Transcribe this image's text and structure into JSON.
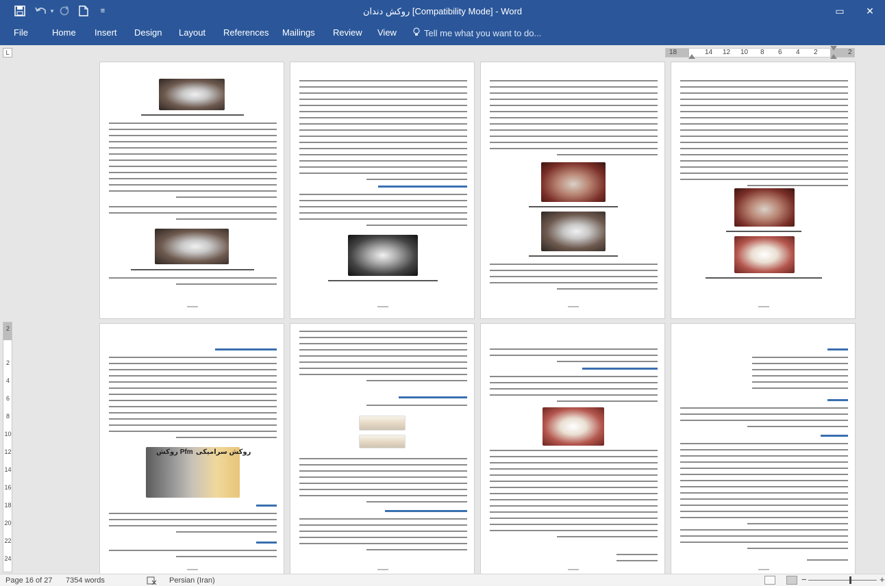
{
  "app": {
    "title": "روکش دندان [Compatibility Mode] - Word"
  },
  "quick_access": {
    "save_icon": "save-icon",
    "undo_icon": "undo-icon",
    "redo_icon": "redo-icon",
    "new_icon": "new-document-icon",
    "customize_icon": "customize-qat-icon"
  },
  "window_controls": {
    "ribbon_display": "▭",
    "minimize": "—",
    "maximize": "❐",
    "close": "✕"
  },
  "ribbon": {
    "tabs": [
      {
        "label": "File"
      },
      {
        "label": "Home"
      },
      {
        "label": "Insert"
      },
      {
        "label": "Design"
      },
      {
        "label": "Layout"
      },
      {
        "label": "References"
      },
      {
        "label": "Mailings"
      },
      {
        "label": "Review"
      },
      {
        "label": "View"
      }
    ],
    "tell_me": "Tell me what you want to do..."
  },
  "ruler": {
    "corner": "L",
    "ticks": [
      "18",
      "14",
      "12",
      "10",
      "8",
      "6",
      "4",
      "2",
      "2"
    ],
    "vertical_ticks": [
      "2",
      "2",
      "4",
      "6",
      "8",
      "10",
      "12",
      "14",
      "16",
      "18",
      "20",
      "22",
      "24"
    ]
  },
  "pages": {
    "row1_page_numbers": [
      "9",
      "10",
      "11",
      "12"
    ],
    "row2_page_numbers": [
      "13",
      "14",
      "15",
      "16"
    ]
  },
  "figures": {
    "pfm_label_right": "روکش Pfm",
    "pfm_label_left": "روکش سرامیکی"
  },
  "statusbar": {
    "page": "Page 16 of 27",
    "words": "7354 words",
    "language": "Persian (Iran)"
  },
  "colors": {
    "brand": "#2b579a",
    "heading": "#3a6fb0"
  }
}
